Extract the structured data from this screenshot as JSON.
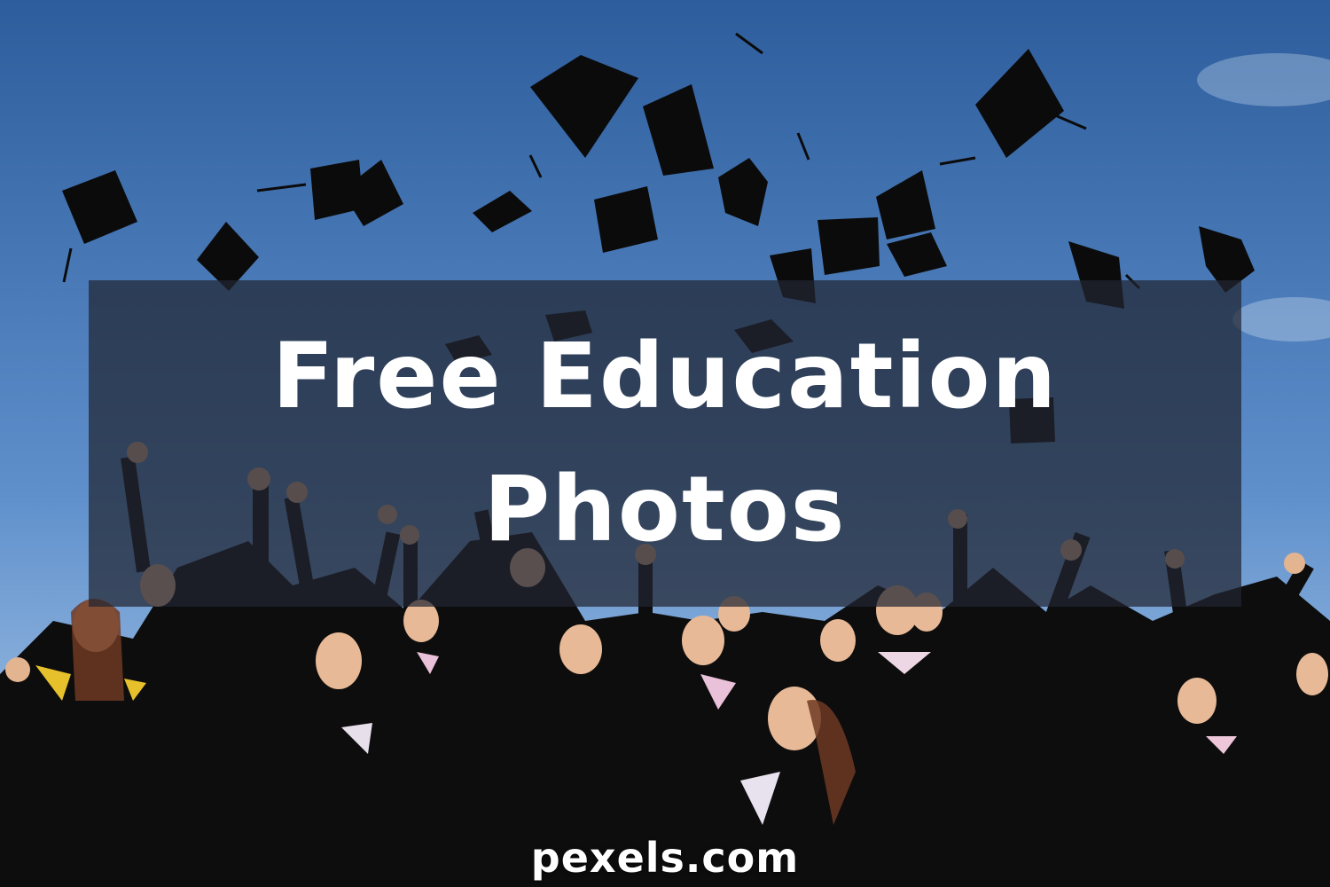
{
  "banner": {
    "title_line1": "Free Education",
    "title_line2": "Photos"
  },
  "watermark": "pexels.com",
  "photo": {
    "subject": "graduates in black gowns throwing mortarboard caps into a blue sky",
    "colors": {
      "sky_top": "#2e5f9e",
      "sky_bottom": "#a9c9ea",
      "gown": "#111111",
      "overlay": "#212632"
    }
  }
}
